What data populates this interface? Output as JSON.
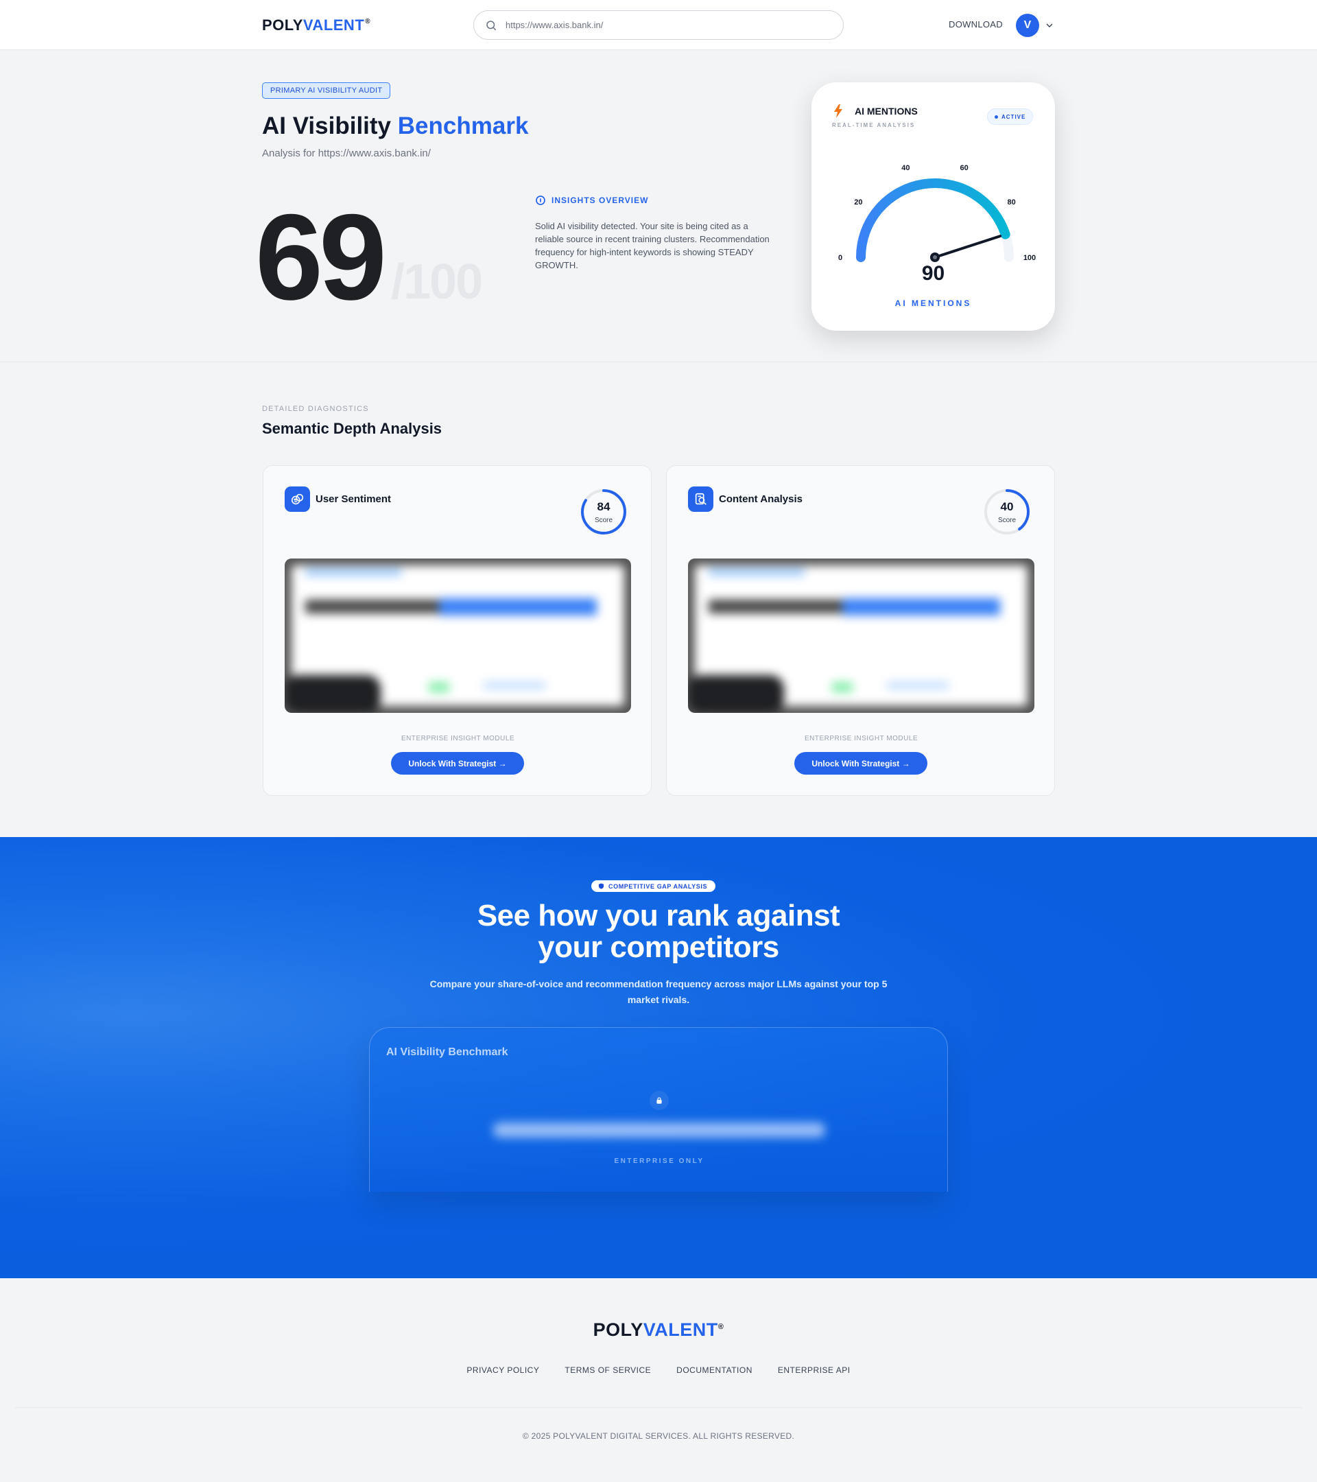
{
  "header": {
    "logo_prefix": "POLY",
    "logo_accent": "VALENT",
    "logo_mark": "®",
    "search_value": "https://www.axis.bank.in/",
    "download_label": "DOWNLOAD",
    "avatar_initial": "V"
  },
  "hero": {
    "badge": "PRIMARY AI VISIBILITY AUDIT",
    "title_main": "AI Visibility",
    "title_accent": "Benchmark",
    "subtitle": "Analysis for https://www.axis.bank.in/",
    "score": "69",
    "score_max": "/100",
    "insights_title": "INSIGHTS OVERVIEW",
    "insights_body": "Solid AI visibility detected. Your site is being cited as a reliable source in recent training clusters. Recommendation frequency for high-intent keywords is showing STEADY GROWTH."
  },
  "gauge_card": {
    "title": "AI MENTIONS",
    "subtitle": "REAL-TIME ANALYSIS",
    "status": "ACTIVE",
    "value": 90,
    "value_label": "90",
    "footer_label": "AI MENTIONS",
    "ticks": [
      "0",
      "20",
      "40",
      "60",
      "80",
      "100"
    ],
    "min": 0,
    "max": 100,
    "colors": {
      "arc_start": "#3b82f6",
      "arc_end": "#06b6d4",
      "needle": "#111827"
    }
  },
  "diagnostics": {
    "eyebrow": "DETAILED DIAGNOSTICS",
    "title": "Semantic Depth Analysis",
    "cards": [
      {
        "title": "User Sentiment",
        "score": 84,
        "score_text": "84",
        "score_label": "Score",
        "icon": "sentiment-icon",
        "module_label": "ENTERPRISE INSIGHT MODULE",
        "button": "Unlock With Strategist →"
      },
      {
        "title": "Content Analysis",
        "score": 40,
        "score_text": "40",
        "score_label": "Score",
        "icon": "content-analysis-icon",
        "module_label": "ENTERPRISE INSIGHT MODULE",
        "button": "Unlock With Strategist →"
      }
    ]
  },
  "competitors": {
    "badge": "COMPETITIVE GAP ANALYSIS",
    "title_line1": "See how you rank against",
    "title_line2": "your competitors",
    "subtitle": "Compare your share-of-voice and recommendation frequency across major LLMs against your top 5 market rivals.",
    "locked_card_title": "AI Visibility Benchmark",
    "locked_label": "ENTERPRISE ONLY"
  },
  "footer": {
    "logo_prefix": "POLY",
    "logo_accent": "VALENT",
    "logo_mark": "®",
    "links": [
      "PRIVACY POLICY",
      "TERMS OF SERVICE",
      "DOCUMENTATION",
      "ENTERPRISE API"
    ],
    "copyright": "© 2025 POLYVALENT DIGITAL SERVICES. ALL RIGHTS RESERVED."
  },
  "colors": {
    "brand": "#2563eb",
    "section_blue": "#0a5fdc",
    "dark": "#111827"
  }
}
